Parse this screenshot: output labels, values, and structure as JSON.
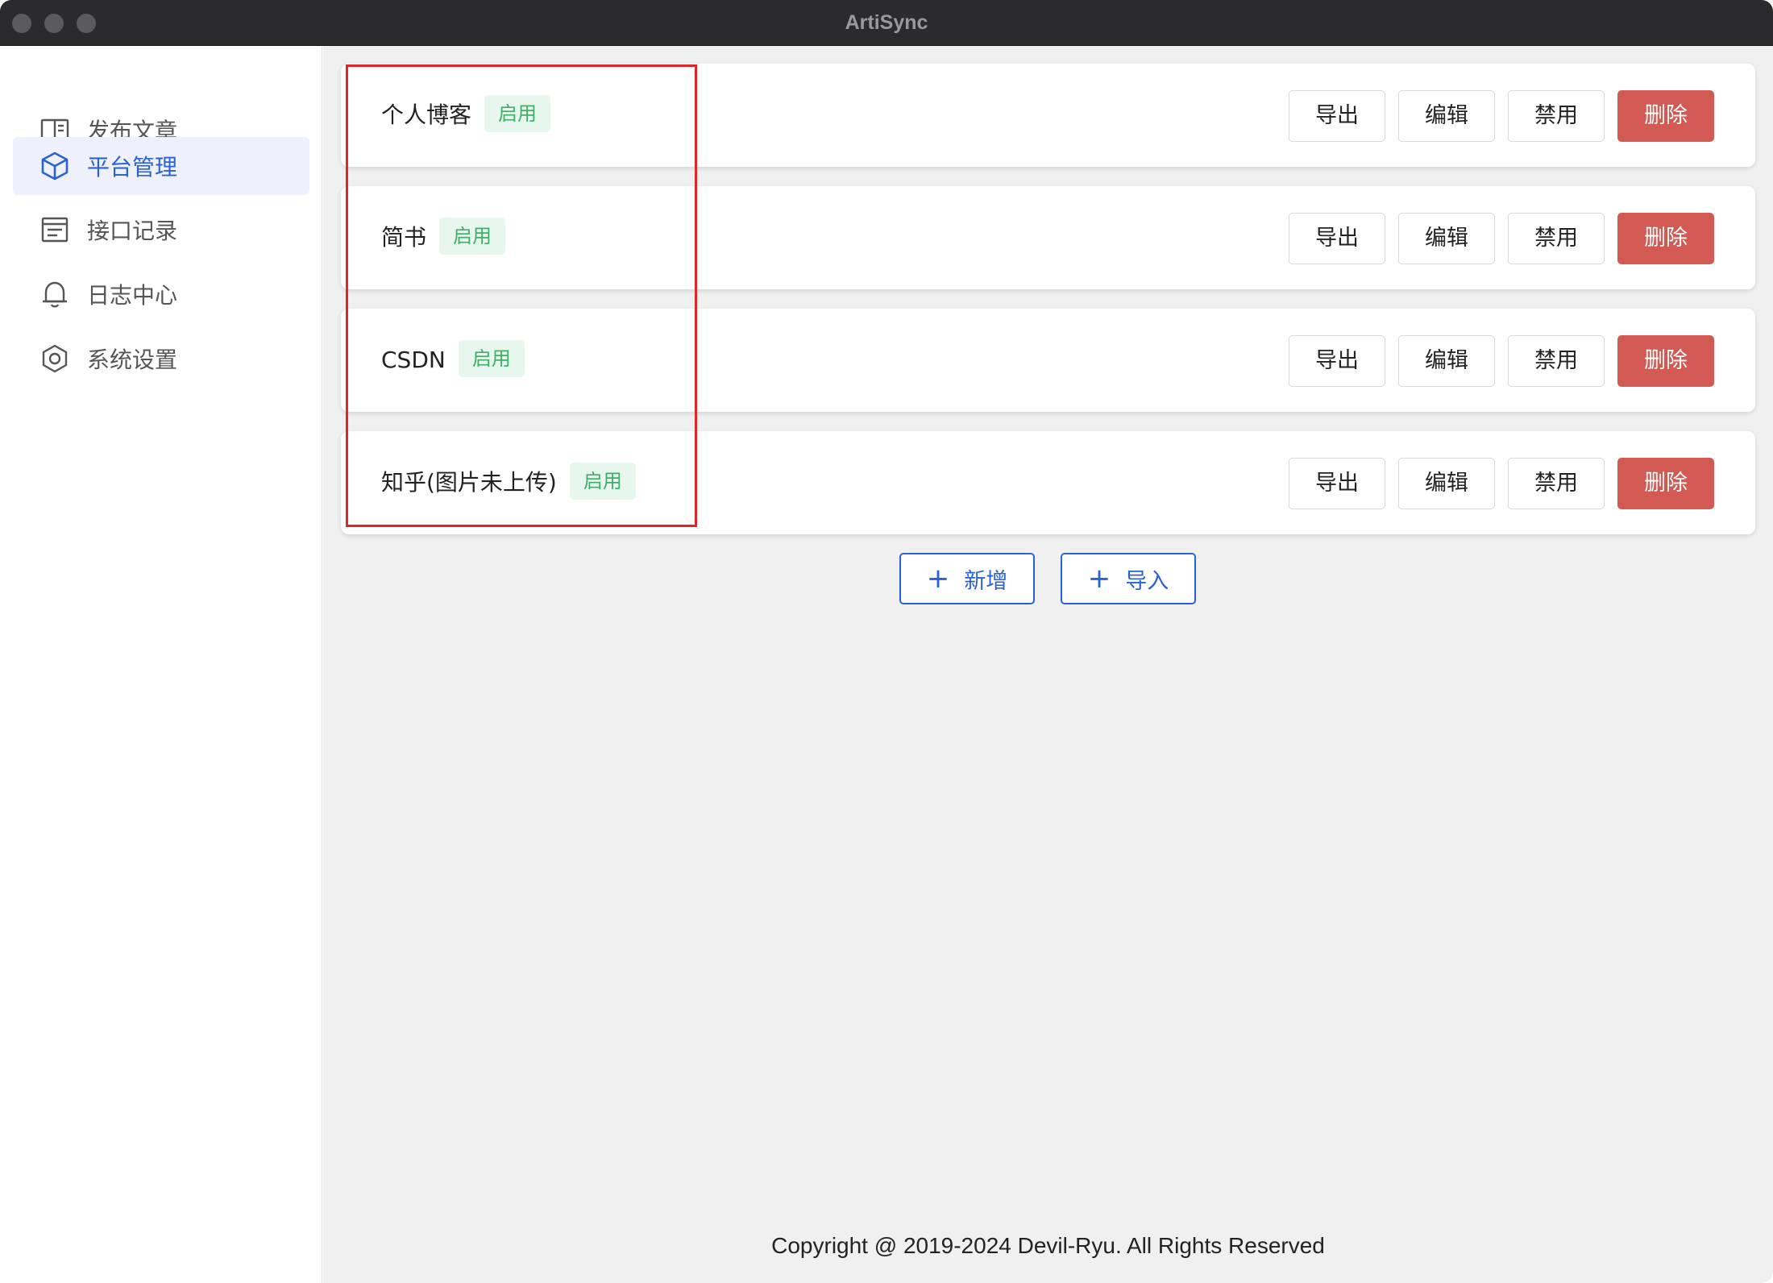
{
  "window": {
    "title": "ArtiSync"
  },
  "sidebar": {
    "items": [
      {
        "label": "发布文章",
        "icon": "book-icon",
        "active": false
      },
      {
        "label": "平台管理",
        "icon": "cube-icon",
        "active": true
      },
      {
        "label": "接口记录",
        "icon": "document-list-icon",
        "active": false
      },
      {
        "label": "日志中心",
        "icon": "bell-icon",
        "active": false
      },
      {
        "label": "系统设置",
        "icon": "hexagon-settings-icon",
        "active": false
      }
    ]
  },
  "platforms": [
    {
      "name": "个人博客",
      "status": "启用"
    },
    {
      "name": "简书",
      "status": "启用"
    },
    {
      "name": "CSDN",
      "status": "启用"
    },
    {
      "name": "知乎(图片未上传)",
      "status": "启用"
    }
  ],
  "row_actions": {
    "export": "导出",
    "edit": "编辑",
    "disable": "禁用",
    "delete": "删除"
  },
  "bottom_actions": {
    "add": "新增",
    "import": "导入"
  },
  "footer": {
    "copyright": "Copyright @ 2019-2024 Devil-Ryu. All Rights Reserved"
  },
  "colors": {
    "accent": "#2a62d6",
    "danger": "#d35a52",
    "badge_text": "#3fae6a",
    "badge_bg": "#e8f7ee",
    "highlight": "#e0262b"
  }
}
